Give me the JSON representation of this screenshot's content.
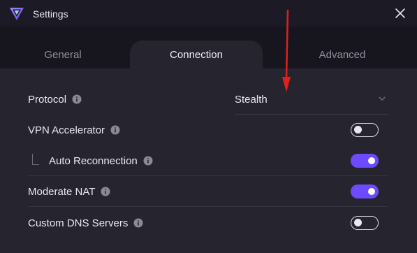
{
  "window": {
    "title": "Settings"
  },
  "tabs": [
    {
      "label": "General",
      "active": false
    },
    {
      "label": "Connection",
      "active": true
    },
    {
      "label": "Advanced",
      "active": false
    }
  ],
  "settings": {
    "protocol": {
      "label": "Protocol",
      "value": "Stealth"
    },
    "vpn_accelerator": {
      "label": "VPN Accelerator",
      "enabled": false
    },
    "auto_reconnection": {
      "label": "Auto Reconnection",
      "enabled": true
    },
    "moderate_nat": {
      "label": "Moderate NAT",
      "enabled": true
    },
    "custom_dns": {
      "label": "Custom DNS Servers",
      "enabled": false
    }
  },
  "colors": {
    "accent": "#6d4aff",
    "annotation_arrow": "#e0201b",
    "background": "#26252f"
  },
  "icons": [
    "app-logo-icon",
    "close-icon",
    "info-icon",
    "chevron-down-icon"
  ]
}
